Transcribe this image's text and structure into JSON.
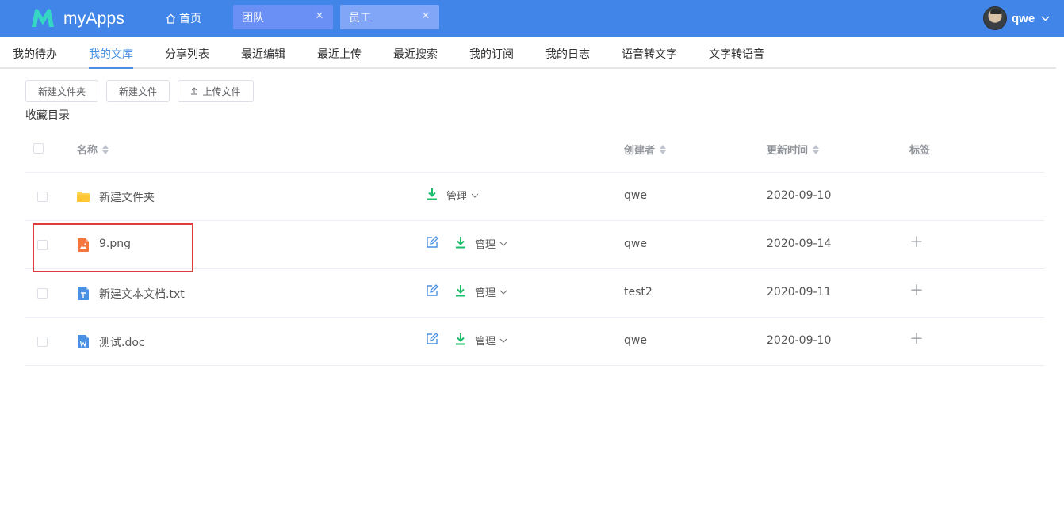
{
  "topbar": {
    "app_name": "myApps",
    "home_label": "首页",
    "tabs": [
      {
        "label": "团队",
        "close": "✕"
      },
      {
        "label": "员工",
        "close": "✕"
      }
    ],
    "user_name": "qwe"
  },
  "nav": {
    "items": [
      "我的待办",
      "我的文库",
      "分享列表",
      "最近编辑",
      "最近上传",
      "最近搜索",
      "我的订阅",
      "我的日志",
      "语音转文字",
      "文字转语音"
    ],
    "active_index": 1
  },
  "toolbar": {
    "new_folder": "新建文件夹",
    "new_file": "新建文件",
    "upload": "上传文件",
    "favorites": "收藏目录"
  },
  "table": {
    "headers": {
      "name": "名称",
      "creator": "创建者",
      "updated": "更新时间",
      "tags": "标签"
    },
    "manage_label": "管理",
    "rows": [
      {
        "name": "新建文件夹",
        "icon": "folder-icon",
        "creator": "qwe",
        "date": "2020-09-10",
        "editable": false,
        "tag_add": false
      },
      {
        "name": "9.png",
        "icon": "image-file-icon",
        "creator": "qwe",
        "date": "2020-09-14",
        "editable": true,
        "tag_add": true
      },
      {
        "name": "新建文本文档.txt",
        "icon": "text-file-icon",
        "creator": "test2",
        "date": "2020-09-11",
        "editable": true,
        "tag_add": true
      },
      {
        "name": "测试.doc",
        "icon": "word-file-icon",
        "creator": "qwe",
        "date": "2020-09-10",
        "editable": true,
        "tag_add": true
      }
    ]
  },
  "colors": {
    "topbar": "#4285e8",
    "accent": "#4a90e2",
    "download": "#19be6b",
    "highlight": "#e03c3c"
  }
}
